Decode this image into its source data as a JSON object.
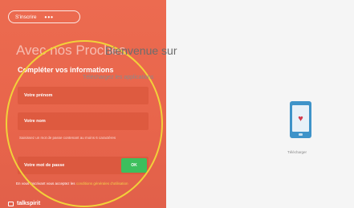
{
  "header": {
    "pill_label": "S'inscrire",
    "pill_dots": "•••"
  },
  "left_panel": {
    "brand_title": "Avec nos Proches",
    "section_title": "Compléter vos informations",
    "first_name_placeholder": "Votre prénom",
    "last_name_placeholder": "Votre nom",
    "password_hint": "Saisissez un mot de passe contenant au moins 6 caractères",
    "password_placeholder": "Votre mot de passe",
    "ok_label": "OK",
    "terms_prefix": "En vous inscrivant vous acceptez les",
    "terms_link": "conditions générales d'utilisation",
    "footer_brand": "talkspirit"
  },
  "main": {
    "welcome": "Bienvenue sur",
    "subtitle": "Téléchargez les applications",
    "download_label": "Télécharger",
    "heart_icon": "heart"
  },
  "colors": {
    "panel": "#ec6b50",
    "ok_button": "#3dbf5d",
    "highlight": "#f2d13a",
    "phone": "#3e93c9"
  }
}
